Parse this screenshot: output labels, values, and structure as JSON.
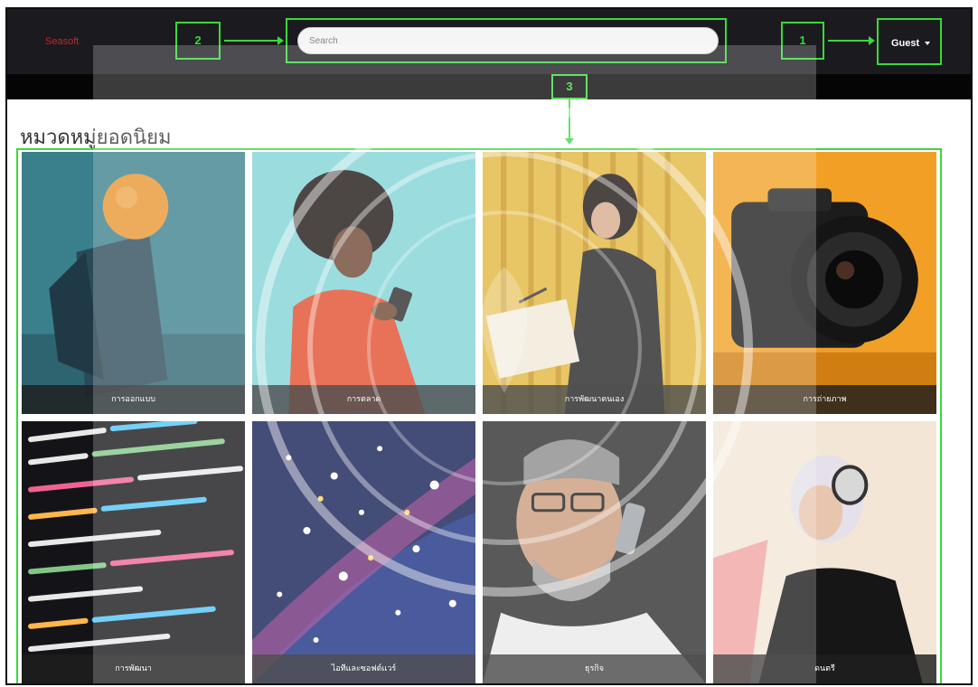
{
  "navbar": {
    "brand": "Seasoft",
    "search_placeholder": "Search",
    "guest_label": "Guest"
  },
  "annotations": {
    "label_1": "1",
    "label_2": "2",
    "label_3": "3"
  },
  "section": {
    "title": "หมวดหมู่ยอดนิยม"
  },
  "categories": [
    {
      "label": "การออกแบบ",
      "theme": "geometric-shapes"
    },
    {
      "label": "การตลาด",
      "theme": "person-with-phone"
    },
    {
      "label": "การพัฒนาตนเอง",
      "theme": "person-writing"
    },
    {
      "label": "การถ่ายภาพ",
      "theme": "camera"
    },
    {
      "label": "การพัฒนา",
      "theme": "code-screen"
    },
    {
      "label": "ไอทีและซอฟต์แวร์",
      "theme": "fiber-optics"
    },
    {
      "label": "ธุรกิจ",
      "theme": "man-on-phone"
    },
    {
      "label": "ดนตรี",
      "theme": "woman-headphones"
    }
  ],
  "colors": {
    "navbar_bg": "#1b1a1f",
    "annotation": "#39d93b",
    "brand": "#c1272d"
  }
}
